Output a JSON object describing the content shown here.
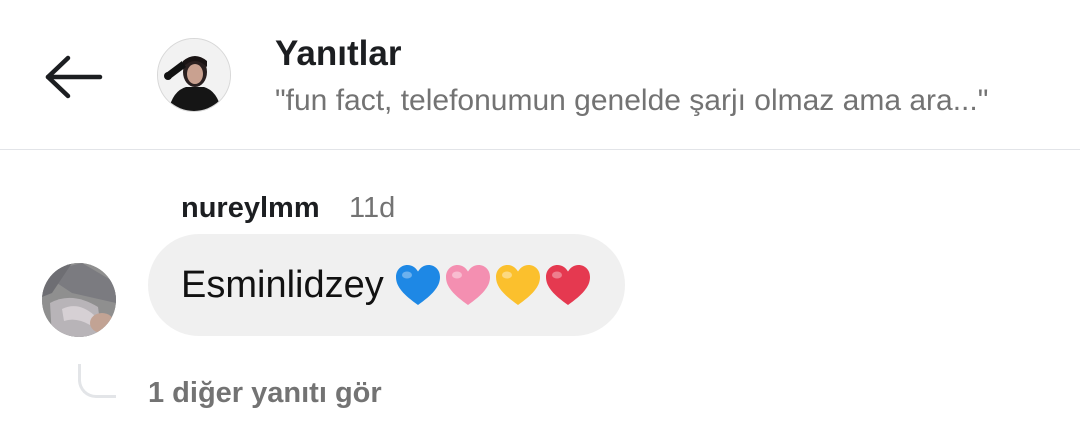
{
  "header": {
    "back_icon": "arrow-left-icon",
    "title": "Yanıtlar",
    "subtitle": "\"fun fact, telefonumun genelde şarjı olmaz ama ara...\"",
    "avatar": "profile-photo"
  },
  "reply": {
    "author": "nureylmm",
    "time": "11d",
    "text": "Esminlidzey",
    "emojis": [
      {
        "name": "blue-heart-icon",
        "color": "#1e88e5"
      },
      {
        "name": "pink-heart-icon",
        "color": "#f48fb1"
      },
      {
        "name": "yellow-heart-icon",
        "color": "#fbc02d"
      },
      {
        "name": "red-heart-icon",
        "color": "#e53950"
      }
    ],
    "avatar": "profile-photo"
  },
  "more_replies": {
    "label": "1 diğer yanıtı gör"
  },
  "colors": {
    "text_primary": "#1c1e21",
    "text_secondary": "#737373",
    "bubble_bg": "#f0f0f0",
    "divider": "#e2e4e8"
  }
}
